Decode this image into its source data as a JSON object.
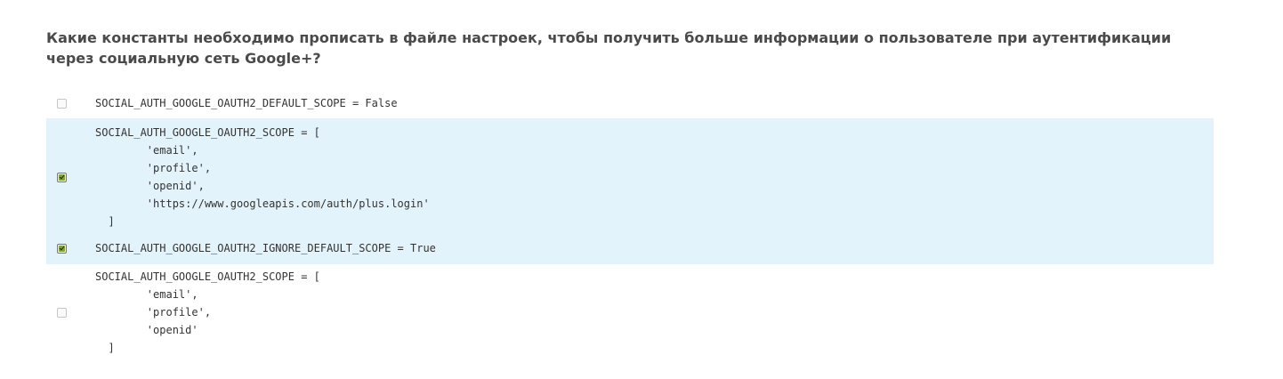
{
  "question": {
    "text": "Какие константы необходимо прописать в файле настроек, чтобы получить больше информации о пользователе при аутентификации через социальную сеть Google+?"
  },
  "options": [
    {
      "checked": false,
      "code": "SOCIAL_AUTH_GOOGLE_OAUTH2_DEFAULT_SCOPE = False"
    },
    {
      "checked": true,
      "code": "SOCIAL_AUTH_GOOGLE_OAUTH2_SCOPE = [\n        'email',\n        'profile',\n        'openid',\n        'https://www.googleapis.com/auth/plus.login'\n  ]"
    },
    {
      "checked": true,
      "code": "SOCIAL_AUTH_GOOGLE_OAUTH2_IGNORE_DEFAULT_SCOPE = True"
    },
    {
      "checked": false,
      "code": "SOCIAL_AUTH_GOOGLE_OAUTH2_SCOPE = [\n        'email',\n        'profile',\n        'openid'\n  ]"
    }
  ],
  "colors": {
    "selected_background": "#e3f3fc",
    "check_green": "#7fa52c"
  },
  "icons": {
    "checked": "checkbox-checked-icon",
    "unchecked": "checkbox-unchecked-icon"
  }
}
